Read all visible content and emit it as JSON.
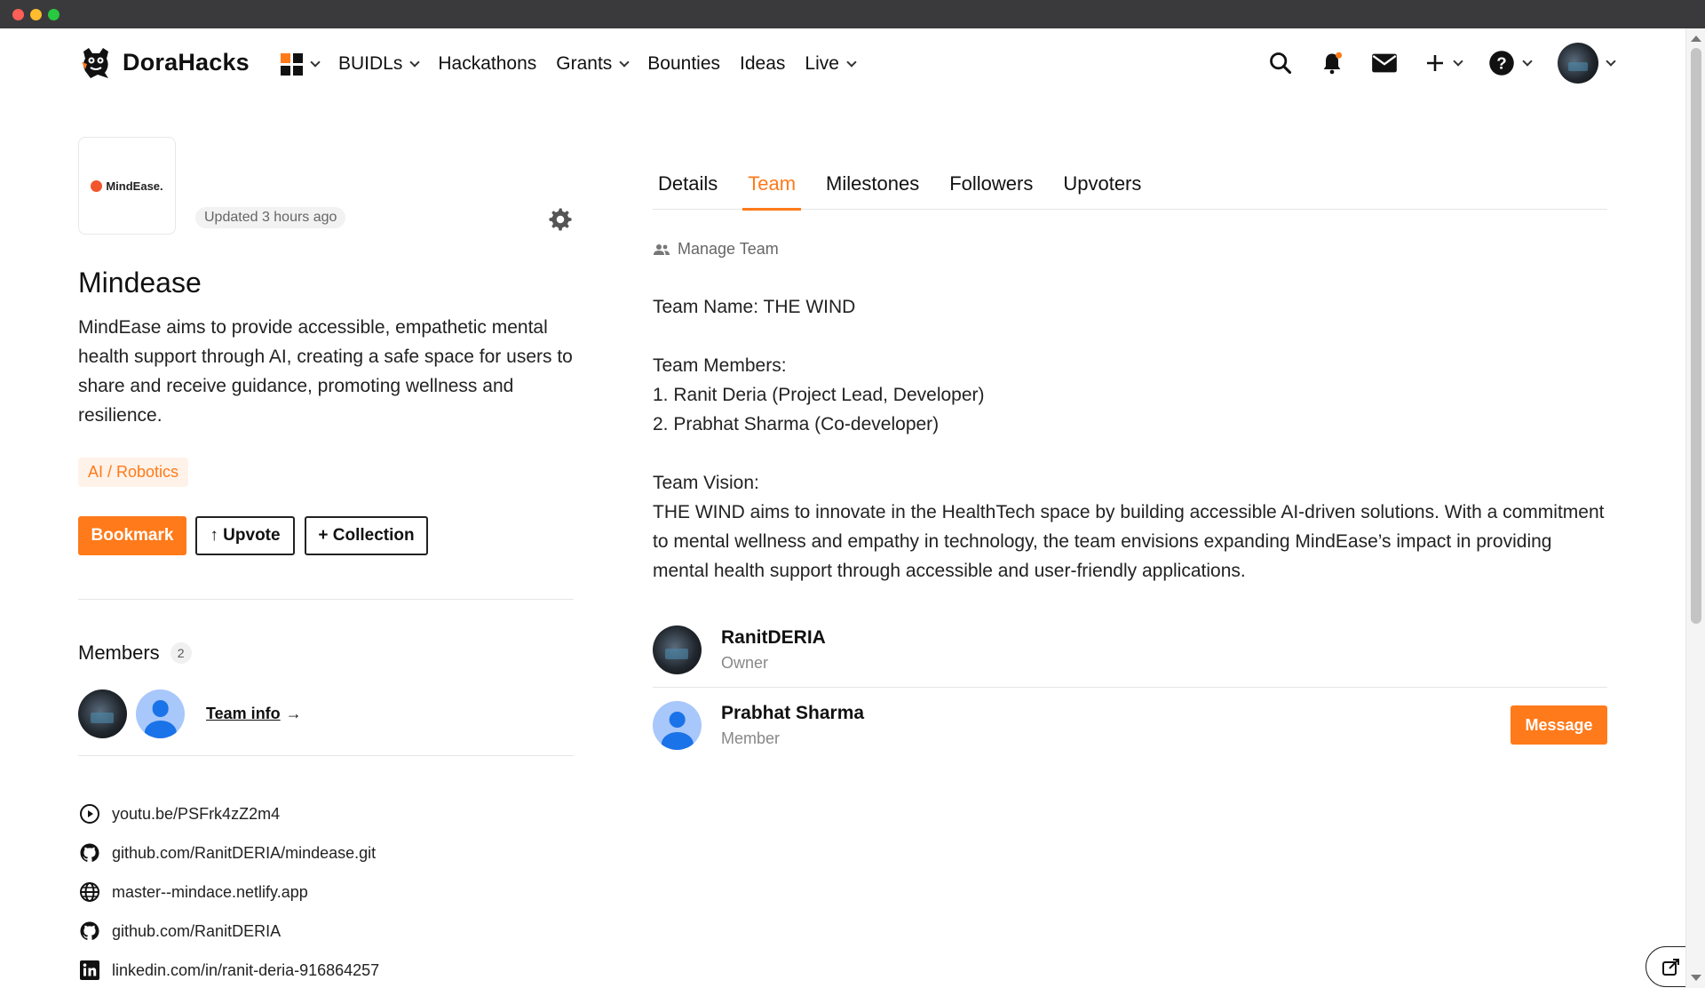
{
  "brand": {
    "name": "DoraHacks",
    "accent": "#ff7a1a"
  },
  "nav": {
    "items": [
      {
        "label": "BUIDLs",
        "dropdown": true
      },
      {
        "label": "Hackathons",
        "dropdown": false
      },
      {
        "label": "Grants",
        "dropdown": true
      },
      {
        "label": "Bounties",
        "dropdown": false
      },
      {
        "label": "Ideas",
        "dropdown": false
      },
      {
        "label": "Live",
        "dropdown": true
      }
    ],
    "right_icons": [
      "search-icon",
      "bell-icon",
      "mail-icon",
      "plus-icon",
      "help-icon",
      "avatar"
    ]
  },
  "project": {
    "logo_text": "MindEase.",
    "updated": "Updated 3 hours ago",
    "title": "Mindease",
    "description": "MindEase aims to provide accessible, empathetic mental health support through AI, creating a safe space for users to share and receive guidance, promoting wellness and resilience.",
    "tag": "AI / Robotics",
    "buttons": {
      "bookmark": "Bookmark",
      "upvote": "↑ Upvote",
      "collection": "+ Collection"
    }
  },
  "members": {
    "title": "Members",
    "count": "2",
    "team_info": "Team info",
    "team_info_arrow": "→"
  },
  "links": [
    {
      "icon": "play-circle-icon",
      "text": "youtu.be/PSFrk4zZ2m4"
    },
    {
      "icon": "github-icon",
      "text": "github.com/RanitDERIA/mindease.git"
    },
    {
      "icon": "globe-icon",
      "text": "master--mindace.netlify.app"
    },
    {
      "icon": "github-icon",
      "text": "github.com/RanitDERIA"
    },
    {
      "icon": "linkedin-icon",
      "text": "linkedin.com/in/ranit-deria-916864257"
    }
  ],
  "tabs": [
    {
      "label": "Details",
      "active": false
    },
    {
      "label": "Team",
      "active": true
    },
    {
      "label": "Milestones",
      "active": false
    },
    {
      "label": "Followers",
      "active": false
    },
    {
      "label": "Upvoters",
      "active": false
    }
  ],
  "team": {
    "manage_label": "Manage Team",
    "name_line": "Team Name: THE WIND",
    "members_heading": "Team Members:",
    "member_lines": [
      "1. Ranit Deria (Project Lead, Developer)",
      "2. Prabhat Sharma (Co-developer)"
    ],
    "vision_heading": "Team Vision:",
    "vision_text": "THE WIND aims to innovate in the HealthTech space by building accessible AI-driven solutions. With a commitment to mental wellness and empathy in technology, the team envisions expanding MindEase’s impact in providing mental health support through accessible and user-friendly applications."
  },
  "team_members": [
    {
      "name": "RanitDERIA",
      "role": "Owner"
    },
    {
      "name": "Prabhat Sharma",
      "role": "Member",
      "action": "Message"
    }
  ]
}
